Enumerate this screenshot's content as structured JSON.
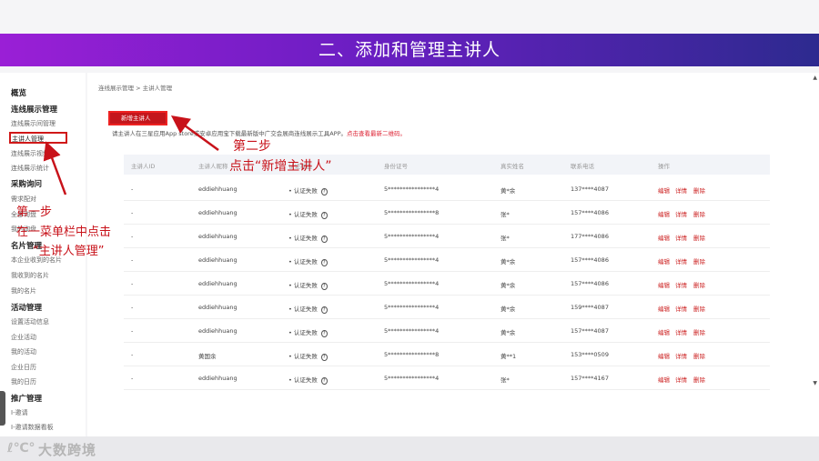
{
  "slide": {
    "title": "二、添加和管理主讲人",
    "footer_logo_mark": "ℓ℃°",
    "footer_brand": "大数跨境"
  },
  "sidebar": {
    "overview": "概览",
    "group_live": "连线展示管理",
    "item_live_manage": "连线展示间管理",
    "item_speaker": "主讲人管理",
    "item_live_video": "连线展示视频",
    "item_live_stats": "连线展示统计",
    "group_purchase": "采购询问",
    "item_purchase_match": "需求配对",
    "item_purchase_all": "全部询盘",
    "item_purchase_my": "我的询盘",
    "group_card": "名片管理",
    "item_card_company": "本企业收到的名片",
    "item_card_received": "我收到的名片",
    "item_card_mine": "我的名片",
    "group_event": "活动管理",
    "item_event_settings": "设置活动信息",
    "item_event_company": "企业活动",
    "item_event_mine": "我的活动",
    "item_event_calendar": "企业日历",
    "item_event_my_calendar": "我的日历",
    "group_promo": "推广管理",
    "item_promo_invite": "I-邀请",
    "item_promo_data": "I-邀请数据看板"
  },
  "main": {
    "breadcrumb": "连线展示管理 > 主讲人管理",
    "add_button": "新增主讲人",
    "notice_text": "请主讲人在三星应用App store或安卓应用宝下载最新版中广交会展商连线展示工具APP。",
    "notice_link": "点击查看最新二维码。",
    "columns": [
      "主讲人ID",
      "主讲人昵称",
      "认证状态",
      "身份证号",
      "真实姓名",
      "联系电话",
      "操作"
    ],
    "status_icon": "?",
    "actions": [
      "编辑",
      "详情",
      "删除"
    ],
    "rows": [
      {
        "id": "-",
        "nick": "eddiehhuang",
        "status": "认证失败",
        "idno": "5****************4",
        "name": "黄*余",
        "phone": "137****4087"
      },
      {
        "id": "-",
        "nick": "eddiehhuang",
        "status": "认证失败",
        "idno": "5****************8",
        "name": "张*",
        "phone": "157****4086"
      },
      {
        "id": "-",
        "nick": "eddiehhuang",
        "status": "认证失败",
        "idno": "5****************4",
        "name": "张*",
        "phone": "177****4086"
      },
      {
        "id": "-",
        "nick": "eddiehhuang",
        "status": "认证失败",
        "idno": "5****************4",
        "name": "黄*余",
        "phone": "157****4086"
      },
      {
        "id": "-",
        "nick": "eddiehhuang",
        "status": "认证失败",
        "idno": "5****************4",
        "name": "黄*余",
        "phone": "157****4086"
      },
      {
        "id": "-",
        "nick": "eddiehhuang",
        "status": "认证失败",
        "idno": "5****************4",
        "name": "黄*余",
        "phone": "159****4087"
      },
      {
        "id": "-",
        "nick": "eddiehhuang",
        "status": "认证失败",
        "idno": "5****************4",
        "name": "黄*余",
        "phone": "157****4087"
      },
      {
        "id": "-",
        "nick": "黄国余",
        "status": "认证失败",
        "idno": "5****************8",
        "name": "黄**1",
        "phone": "153****0509"
      },
      {
        "id": "-",
        "nick": "eddiehhuang",
        "status": "认证失败",
        "idno": "5****************4",
        "name": "张*",
        "phone": "157****4167"
      }
    ]
  },
  "annotations": {
    "step1_line1": "第一步",
    "step1_line2": "在一菜单栏中点击",
    "step1_line3": "“主讲人管理”",
    "step2_line1": "第二步",
    "step2_line2": "点击“新增主讲人”"
  },
  "colors": {
    "accent": "#c4161c",
    "banner_left": "#9a1fd6",
    "banner_right": "#2d2a8f"
  }
}
